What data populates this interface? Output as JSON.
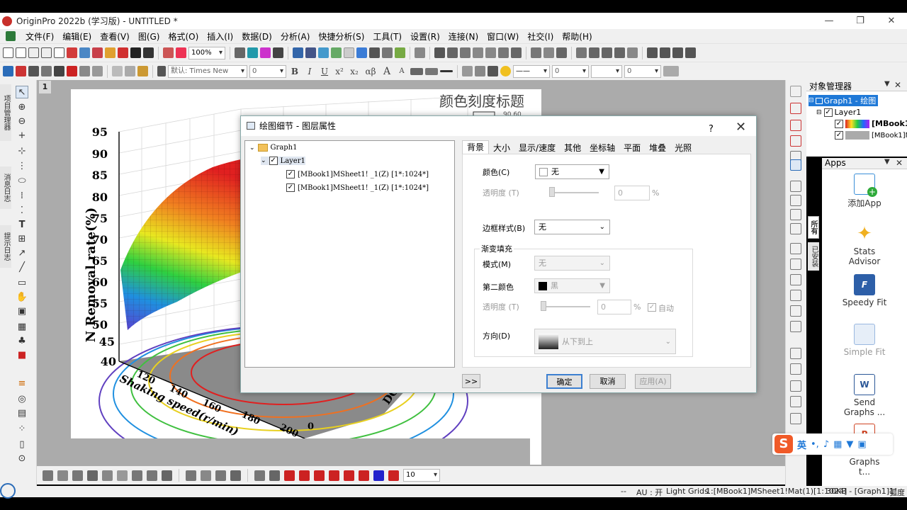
{
  "window": {
    "title": "OriginPro 2022b (学习版) - UNTITLED *",
    "minimize": "—",
    "restore": "❐",
    "close": "✕"
  },
  "menu": [
    "文件(F)",
    "编辑(E)",
    "查看(V)",
    "图(G)",
    "格式(O)",
    "插入(I)",
    "数据(D)",
    "分析(A)",
    "快捷分析(S)",
    "工具(T)",
    "设置(R)",
    "连接(N)",
    "窗口(W)",
    "社交(I)",
    "帮助(H)"
  ],
  "toolbar": {
    "zoom": "100%",
    "font_name": "默认: Times New",
    "font_size": "0",
    "bold": "B",
    "italic": "I",
    "underline": "U",
    "superscript": "x²",
    "subscript": "x₂",
    "greek": "αβ",
    "larger": "A",
    "smaller": "A",
    "line_width": "0",
    "symbol_size": "0",
    "bottom_value": "10"
  },
  "left_tabs": [
    "项目管理器",
    "消息日志",
    "提示日志"
  ],
  "workspace": {
    "page_number": "1"
  },
  "graph": {
    "title": "颜色刻度标题",
    "color_scale_label": "90.60",
    "y_axis_label": "N Removal rate(%)",
    "y_ticks": [
      "95",
      "90",
      "85",
      "80",
      "75",
      "70",
      "65",
      "60",
      "55",
      "50",
      "45",
      "40"
    ],
    "x_axis_label": "Shaking speed(r/min)",
    "x_ticks": [
      "120",
      "140",
      "160",
      "180",
      "200"
    ],
    "z_axis_label": "DO(",
    "zero_tick": "0"
  },
  "dialog": {
    "title": "绘图细节 - 图层属性",
    "help": "?",
    "close": "✕",
    "tree": {
      "root": "Graph1",
      "layer": "Layer1",
      "plots": [
        "[MBook1]MSheet1! _1(Z) [1*:1024*]",
        "[MBook1]MSheet1! _1(Z) [1*:1024*]"
      ]
    },
    "tabs": [
      "背景",
      "大小",
      "显示/速度",
      "其他",
      "坐标轴",
      "平面",
      "堆叠",
      "光照"
    ],
    "active_tab": "背景",
    "fields": {
      "color_label": "颜色(C)",
      "color_value": "无",
      "transparency_label": "透明度 (T)",
      "transparency_value": "0",
      "percent": "%",
      "border_label": "边框样式(B)",
      "border_value": "无",
      "gradient_group": "渐变填充",
      "mode_label": "模式(M)",
      "mode_value": "无",
      "second_color_label": "第二颜色",
      "second_color_value": "黑",
      "transparency2_label": "透明度 (T)",
      "transparency2_value": "0",
      "auto_label": "自动",
      "direction_label": "方向(D)",
      "direction_value": "从下到上"
    },
    "buttons": {
      "expand": ">>",
      "ok": "确定",
      "cancel": "取消",
      "apply": "应用(A)"
    }
  },
  "object_manager": {
    "title": "对象管理器",
    "graph": "Graph1 - 绘图",
    "layer": "Layer1",
    "items": [
      "[MBook1",
      "[MBook1]M"
    ]
  },
  "apps_panel": {
    "title": "Apps",
    "side_tabs": [
      "所有",
      "已安装"
    ],
    "apps": [
      {
        "name": "添加App",
        "color": "#3a8fd8"
      },
      {
        "name": "Stats Advisor",
        "color": "#f0b020"
      },
      {
        "name": "Speedy Fit",
        "color": "#2d5fa8"
      },
      {
        "name": "Simple Fit",
        "color": "#9ab8e0"
      },
      {
        "name": "Send Graphs ...",
        "color": "#2b5797"
      },
      {
        "name": "Send Graphs t...",
        "color": "#d04423"
      }
    ]
  },
  "status": {
    "dots": "--",
    "au": "AU : 开",
    "grids": "Light Grids",
    "info": "1:[MBook1]MSheet1!Mat(1)[1:1024]",
    "size": "30KB - [Graph1]1!",
    "unit": "弧度"
  },
  "ime": {
    "logo": "S",
    "lang": "英"
  }
}
